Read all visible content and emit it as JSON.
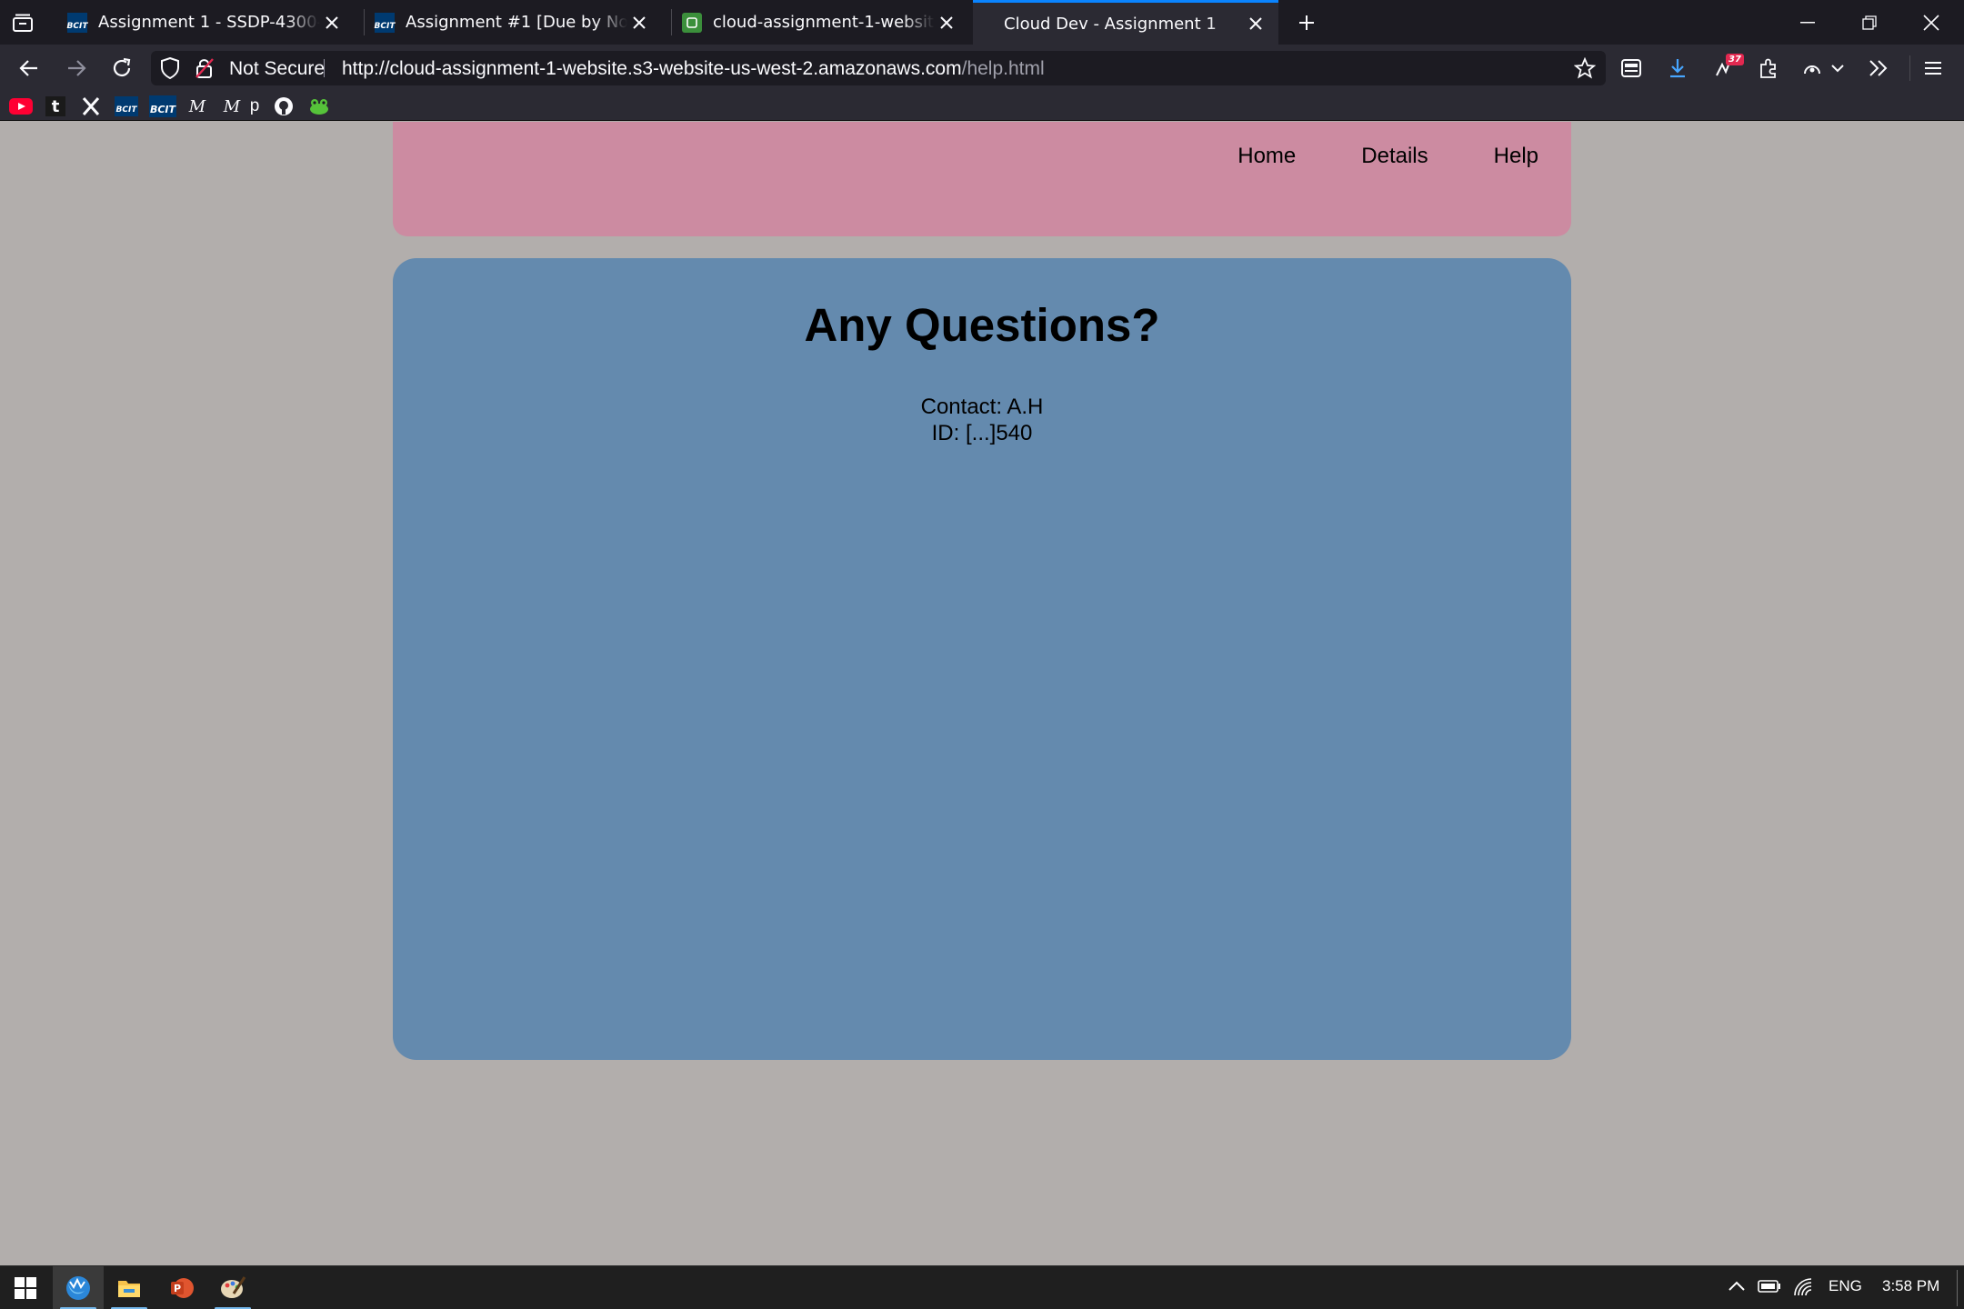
{
  "browser": {
    "tabs": [
      {
        "title": "Assignment 1 - SSDP-4300-0 - ...",
        "favicon": "bcit-icon",
        "active": false
      },
      {
        "title": "Assignment #1 [Due by Noon on ...",
        "favicon": "bcit-icon",
        "active": false
      },
      {
        "title": "cloud-assignment-1-website - S3 ...",
        "favicon": "s3-bucket-icon",
        "active": false
      },
      {
        "title": "Cloud Dev - Assignment 1",
        "favicon": "",
        "active": true
      }
    ],
    "security_label": "Not Secure",
    "url_main": "http://cloud-assignment-1-website.s3-website-us-west-2.amazonaws.com",
    "url_path": "/help.html",
    "extension_badge": "37",
    "bookmarks": [
      {
        "name": "youtube-icon",
        "label": ""
      },
      {
        "name": "tumblr-icon",
        "label": "t"
      },
      {
        "name": "x-icon",
        "label": "X"
      },
      {
        "name": "bcit-icon",
        "label": "BCIT"
      },
      {
        "name": "bcit-icon",
        "label": "BCIT"
      },
      {
        "name": "medium-icon",
        "label": "M"
      },
      {
        "name": "medium-icon",
        "label": "M"
      },
      {
        "name": "bookmark-p",
        "label": "p"
      },
      {
        "name": "github-icon",
        "label": ""
      },
      {
        "name": "frog-icon",
        "label": ""
      }
    ]
  },
  "page": {
    "nav": [
      "Home",
      "Details",
      "Help"
    ],
    "heading": "Any Questions?",
    "contact_line": "Contact: A.H",
    "id_line": "ID: [...]540"
  },
  "taskbar": {
    "language": "ENG",
    "time": "3:58 PM"
  },
  "colors": {
    "header_bg": "#cc8ba1",
    "main_bg": "#648aae",
    "page_bg": "#b2aeac",
    "accent": "#0a84ff"
  }
}
